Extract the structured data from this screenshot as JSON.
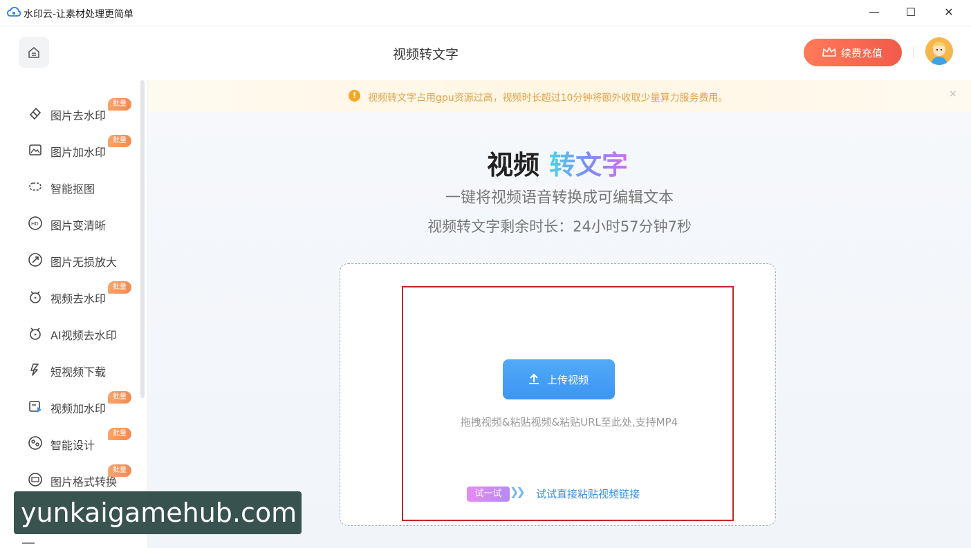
{
  "window": {
    "title": "水印云-让素材处理更简单",
    "minimize": "—",
    "maximize": "☐",
    "close": "✕"
  },
  "header": {
    "page_title": "视频转文字",
    "recharge_label": "续费充值",
    "home_icon": "home-icon",
    "crown_icon": "crown-icon"
  },
  "sidebar": {
    "items": [
      {
        "label": "图片去水印",
        "icon": "eraser-icon",
        "badge": "批量"
      },
      {
        "label": "图片加水印",
        "icon": "image-add-icon",
        "badge": "批量"
      },
      {
        "label": "智能抠图",
        "icon": "cutout-icon",
        "badge": ""
      },
      {
        "label": "图片变清晰",
        "icon": "hd-icon",
        "badge": ""
      },
      {
        "label": "图片无损放大",
        "icon": "enlarge-icon",
        "badge": ""
      },
      {
        "label": "视频去水印",
        "icon": "video-eraser-icon",
        "badge": "批量"
      },
      {
        "label": "AI视频去水印",
        "icon": "ai-video-icon",
        "badge": ""
      },
      {
        "label": "短视频下载",
        "icon": "download-icon",
        "badge": ""
      },
      {
        "label": "视频加水印",
        "icon": "video-add-icon",
        "badge": "批量"
      },
      {
        "label": "智能设计",
        "icon": "design-icon",
        "badge": "批量"
      },
      {
        "label": "图片格式转换",
        "icon": "format-icon",
        "badge": "批量"
      }
    ]
  },
  "notice": {
    "text": "视频转文字占用gpu资源过高，视频时长超过10分钟将额外收取少量算力服务费用。",
    "close": "×"
  },
  "hero": {
    "title_plain": "视频",
    "title_highlight": "转文字",
    "subtitle": "一键将视频语音转换成可编辑文本",
    "remaining": "视频转文字剩余时长：24小时57分钟7秒"
  },
  "dropzone": {
    "upload_label": "上传视频",
    "hint": "拖拽视频&粘贴视频&粘贴URL至此处,支持MP4",
    "try_pill": "试一试",
    "try_link": "试试直接粘贴视频链接"
  },
  "watermark": {
    "text": "yunkaigamehub.com"
  },
  "colors": {
    "accent_blue": "#3d95f2",
    "recharge_orange": "#f25a4a",
    "highlight_red": "#c0282d",
    "notice_text": "#e0a24a"
  }
}
